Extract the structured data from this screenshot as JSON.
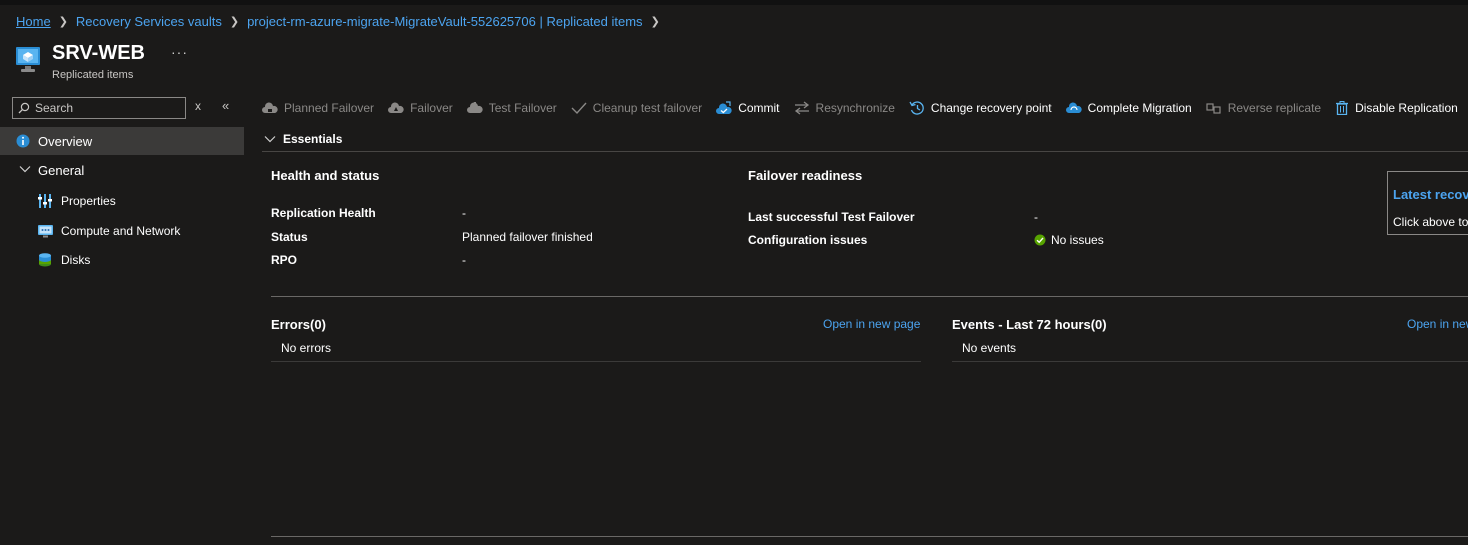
{
  "breadcrumb": {
    "home": "Home",
    "vaults": "Recovery Services vaults",
    "current": "project-rm-azure-migrate-MigrateVault-552625706 | Replicated items"
  },
  "header": {
    "title": "SRV-WEB",
    "subtitle": "Replicated items",
    "more": "···"
  },
  "sidebar": {
    "search_placeholder": "Search",
    "clear": "x",
    "collapse": "«",
    "overview": "Overview",
    "general": "General",
    "items": [
      {
        "label": "Properties",
        "icon": "properties-icon"
      },
      {
        "label": "Compute and Network",
        "icon": "compute-network-icon"
      },
      {
        "label": "Disks",
        "icon": "disks-icon"
      }
    ]
  },
  "toolbar": {
    "planned_failover": "Planned Failover",
    "failover": "Failover",
    "test_failover": "Test Failover",
    "cleanup": "Cleanup test failover",
    "commit": "Commit",
    "resync": "Resynchronize",
    "change_recovery": "Change recovery point",
    "complete_migration": "Complete Migration",
    "reverse": "Reverse replicate",
    "disable": "Disable Replication"
  },
  "essentials": {
    "label": "Essentials",
    "health": {
      "title": "Health and status",
      "rows": [
        {
          "label": "Replication Health",
          "value": "-"
        },
        {
          "label": "Status",
          "value": "Planned failover finished"
        },
        {
          "label": "RPO",
          "value": "-"
        }
      ]
    },
    "failover": {
      "title": "Failover readiness",
      "rows": [
        {
          "label": "Last successful Test Failover",
          "value": "-"
        },
        {
          "label": "Configuration issues",
          "value": "No issues"
        }
      ]
    },
    "recovery": {
      "link": "Latest recovery points",
      "desc": "Click above to see"
    }
  },
  "errors": {
    "title": "Errors(0)",
    "open": "Open in new page",
    "empty": "No errors"
  },
  "events": {
    "title": "Events - Last 72 hours(0)",
    "open": "Open in new page",
    "empty": "No events"
  },
  "colors": {
    "background": "#1b1a19",
    "link": "#4ca4f0",
    "selected": "#3b3a39",
    "disabled": "#8a8886",
    "success": "#57a300"
  }
}
